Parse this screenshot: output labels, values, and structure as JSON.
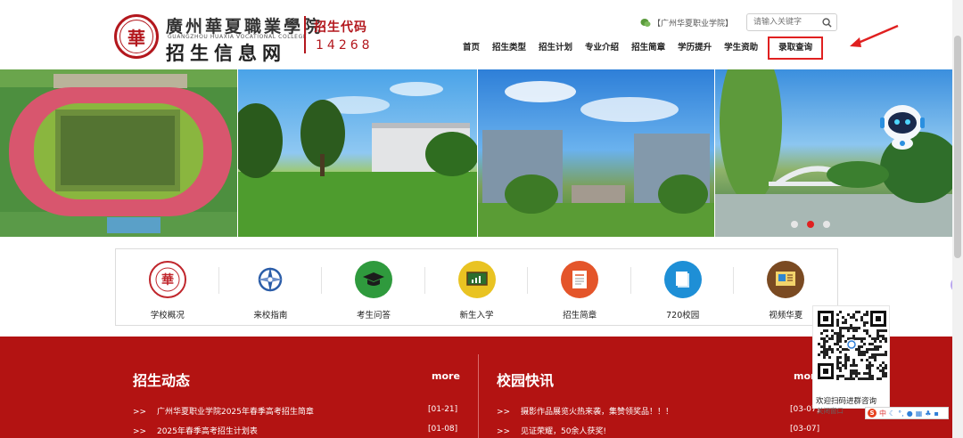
{
  "header": {
    "school_name": "廣州華夏職業學院",
    "school_name_en": "GUANGZHOU HUAXIA VOCATIONAL COLLEGE",
    "site_name": "招生信息网",
    "code_label": "招生代码",
    "code_value": "14268",
    "wechat_label": "【广州华夏职业学院】",
    "search_placeholder": "请输入关键字"
  },
  "nav": {
    "items": [
      {
        "label": "首页"
      },
      {
        "label": "招生类型"
      },
      {
        "label": "招生计划"
      },
      {
        "label": "专业介绍"
      },
      {
        "label": "招生简章"
      },
      {
        "label": "学历提升"
      },
      {
        "label": "学生资助"
      },
      {
        "label": "录取查询"
      }
    ],
    "highlight_color": "#e02020"
  },
  "banner": {
    "slides": [
      "campus-aerial-stadium",
      "campus-lawn-building",
      "campus-gate-towers",
      "campus-lake-bridge"
    ],
    "active_dot": 1,
    "dot_count": 3
  },
  "quick_links": [
    {
      "label": "学校概况",
      "icon": "school-seal-icon",
      "color": "#c0262c"
    },
    {
      "label": "来校指南",
      "icon": "compass-icon",
      "color": "#2b5da8"
    },
    {
      "label": "考生问答",
      "icon": "graduation-cap-icon",
      "color": "#2f9a3d"
    },
    {
      "label": "新生入学",
      "icon": "chalkboard-icon",
      "color": "#e9c322"
    },
    {
      "label": "招生简章",
      "icon": "document-icon",
      "color": "#e4552a"
    },
    {
      "label": "720校园",
      "icon": "panorama-icon",
      "color": "#1e8fd6"
    },
    {
      "label": "视频华夏",
      "icon": "video-icon",
      "color": "#7a4a22"
    }
  ],
  "news": {
    "left": {
      "title": "招生动态",
      "more": "more",
      "items": [
        {
          "bullet": ">>",
          "text": "广州华夏职业学院2025年春季高考招生简章",
          "date": "[01-21]"
        },
        {
          "bullet": ">>",
          "text": "2025年春季高考招生计划表",
          "date": "[01-08]"
        }
      ]
    },
    "right": {
      "title": "校园快讯",
      "more": "more",
      "items": [
        {
          "bullet": ">>",
          "text": "摄影作品展览火热来袭，集赞领奖品！！！",
          "date": "[03-07]"
        },
        {
          "bullet": ">>",
          "text": "见证荣耀，50余人获奖!",
          "date": "[03-07]"
        }
      ]
    },
    "section_color": "#b31312"
  },
  "qr_popup": {
    "text": "欢迎扫码进群咨询",
    "close_label": "关闭窗口"
  },
  "ime": {
    "label": "中"
  }
}
